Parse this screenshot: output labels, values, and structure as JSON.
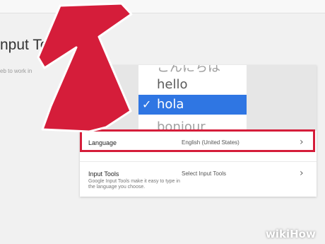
{
  "header": {
    "title": "nput Tools",
    "subtitle": "eb to work in"
  },
  "picker": {
    "items": [
      {
        "label": "こんにちは",
        "state": "faded"
      },
      {
        "label": "hello",
        "state": "normal"
      },
      {
        "label": "hola",
        "state": "selected",
        "check": "✓"
      },
      {
        "label": "bonjour",
        "state": "faded"
      }
    ]
  },
  "settings": {
    "language": {
      "label": "Language",
      "value": "English (United States)",
      "chevron": "›"
    },
    "input_tools": {
      "label": "Input Tools",
      "description": "Google Input Tools make it easy to type in the language you choose.",
      "value": "Select Input Tools",
      "chevron": "›"
    }
  },
  "annotation": {
    "arrow_color": "#d51d3a",
    "highlight_color": "#d51d3a"
  },
  "colors": {
    "selection": "#2f76e3"
  },
  "watermark": "wikiHow"
}
